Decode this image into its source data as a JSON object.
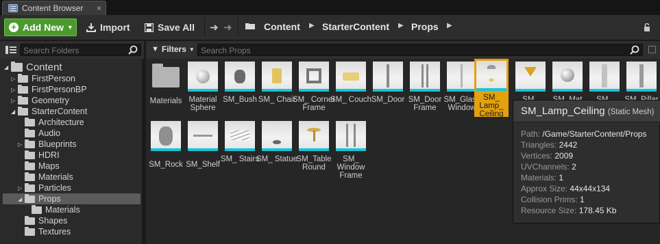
{
  "tab": {
    "title": "Content Browser",
    "close": "×"
  },
  "toolbar": {
    "add_new": "Add New",
    "import": "Import",
    "save_all": "Save All",
    "breadcrumbs": [
      "Content",
      "StarterContent",
      "Props"
    ]
  },
  "folders": {
    "search_placeholder": "Search Folders",
    "tree": [
      {
        "label": "Content",
        "depth": 0,
        "expanded": true
      },
      {
        "label": "FirstPerson",
        "depth": 1,
        "expandable": true
      },
      {
        "label": "FirstPersonBP",
        "depth": 1,
        "expandable": true
      },
      {
        "label": "Geometry",
        "depth": 1,
        "expandable": true
      },
      {
        "label": "StarterContent",
        "depth": 1,
        "expanded": true
      },
      {
        "label": "Architecture",
        "depth": 2
      },
      {
        "label": "Audio",
        "depth": 2
      },
      {
        "label": "Blueprints",
        "depth": 2,
        "expandable": true
      },
      {
        "label": "HDRI",
        "depth": 2
      },
      {
        "label": "Maps",
        "depth": 2
      },
      {
        "label": "Materials",
        "depth": 2
      },
      {
        "label": "Particles",
        "depth": 2,
        "expandable": true
      },
      {
        "label": "Props",
        "depth": 2,
        "expanded": true,
        "selected": true
      },
      {
        "label": "Materials",
        "depth": 3
      },
      {
        "label": "Shapes",
        "depth": 2
      },
      {
        "label": "Textures",
        "depth": 2
      }
    ]
  },
  "assets_panel": {
    "filters_label": "Filters",
    "search_placeholder": "Search Props",
    "row1": [
      "Materials",
      "Material Sphere",
      "SM_Bush",
      "SM_ Chair",
      "SM_ Corner Frame",
      "SM_ Couch",
      "SM_Door",
      "SM_Door Frame",
      "SM_Glass Window",
      "SM_ Lamp_ Ceiling",
      "SM_",
      "SM_Mat",
      "SM_",
      "SM_Pillar"
    ],
    "row2": [
      "SM_Rock",
      "SM_Shelf",
      "SM_ Stairs",
      "SM_ Statue",
      "SM_Table Round",
      "SM_ Window Frame"
    ],
    "selected": "SM_ Lamp_ Ceiling"
  },
  "tooltip": {
    "title": "SM_Lamp_Ceiling",
    "subtitle": "(Static Mesh)",
    "rows": [
      {
        "k": "Path:",
        "v": "/Game/StarterContent/Props"
      },
      {
        "k": "Triangles:",
        "v": "2442"
      },
      {
        "k": "Vertices:",
        "v": "2009"
      },
      {
        "k": "UVChannels:",
        "v": "2"
      },
      {
        "k": "Materials:",
        "v": "1"
      },
      {
        "k": "Approx Size:",
        "v": "44x44x134"
      },
      {
        "k": "Collision Prims:",
        "v": "1"
      },
      {
        "k": "Resource Size:",
        "v": "178.45 Kb"
      }
    ]
  },
  "colors": {
    "accent_green": "#4a9a2f",
    "selection_orange": "#e4a10d",
    "thumb_base": "#19c4d9"
  }
}
